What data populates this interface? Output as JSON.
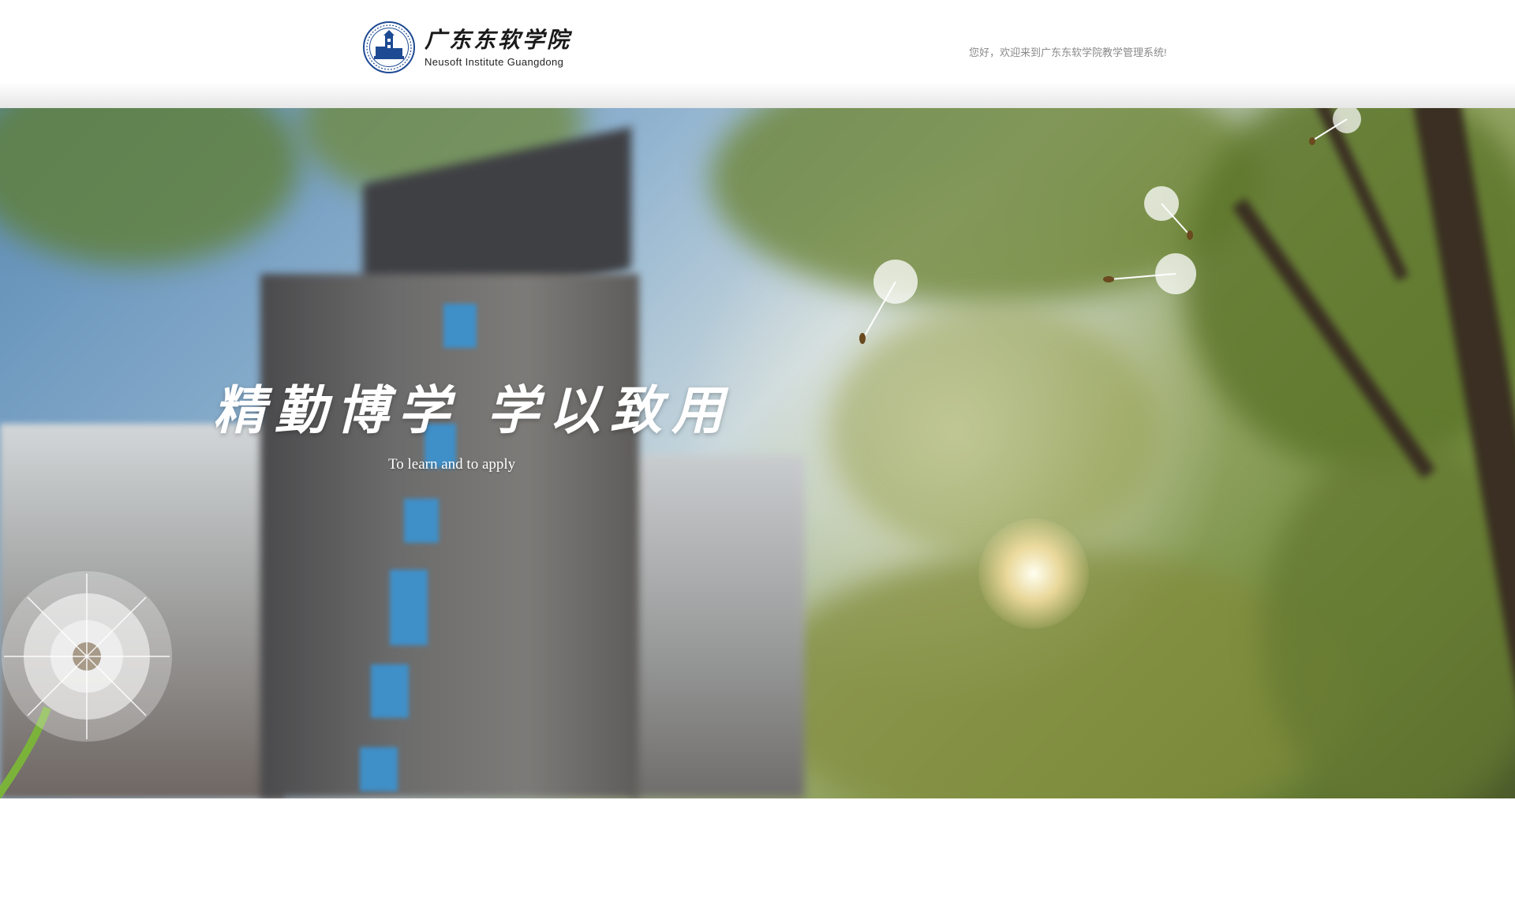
{
  "header": {
    "logo": {
      "name_cn": "广东东软学院",
      "name_en": "Neusoft Institute Guangdong",
      "seal_icon": "school-seal-icon"
    },
    "welcome_text": "您好，欢迎来到广东东软学院教学管理系统!"
  },
  "banner": {
    "motto_cn": "精勤博学  学以致用",
    "motto_en": "To learn and to apply",
    "image": "campus-tower-with-dandelions"
  },
  "colors": {
    "brand_blue": "#1e4a93",
    "welcome_gray": "#8a8a8a",
    "motto_text": "#ffffff"
  }
}
